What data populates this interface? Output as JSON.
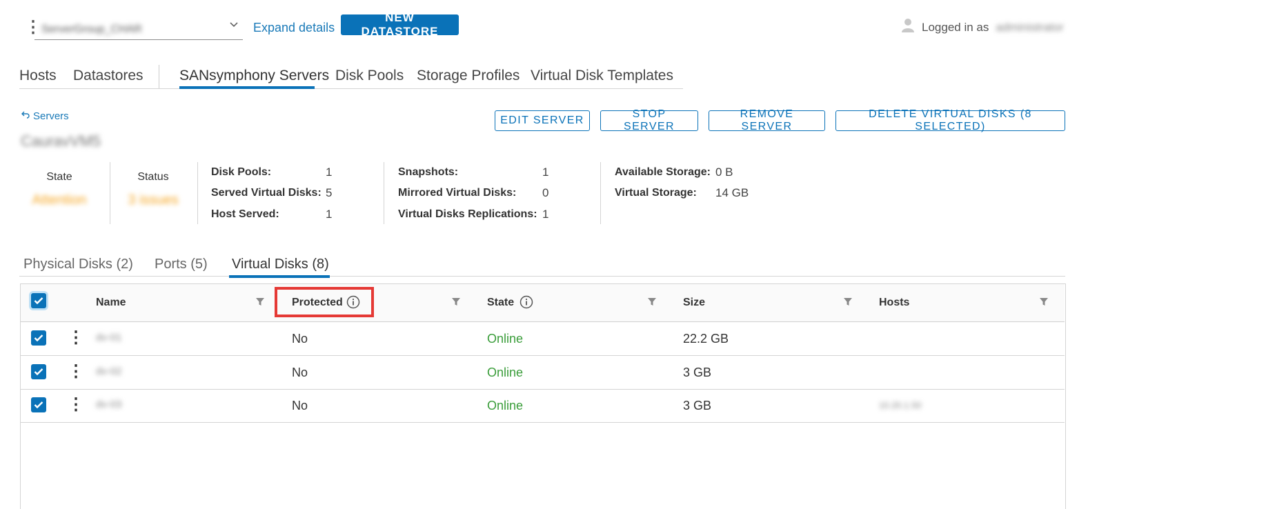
{
  "topbar": {
    "group_value": "ServerGroup_CHAR",
    "expand_details": "Expand details",
    "new_datastore": "NEW DATASTORE",
    "logged_in_as": "Logged in as",
    "username": "administrator"
  },
  "main_tabs": [
    {
      "label": "Hosts"
    },
    {
      "label": "Datastores"
    },
    {
      "label": "SANsymphony Servers"
    },
    {
      "label": "Disk Pools"
    },
    {
      "label": "Storage Profiles"
    },
    {
      "label": "Virtual Disk Templates"
    }
  ],
  "breadcrumb": {
    "label": "Servers"
  },
  "server_name": "CauravVM5",
  "actions": {
    "edit": "EDIT SERVER",
    "stop": "STOP SERVER",
    "remove": "REMOVE SERVER",
    "delete": "DELETE VIRTUAL DISKS (8 SELECTED)"
  },
  "summary": {
    "state_label": "State",
    "state_value": "Attention",
    "status_label": "Status",
    "status_value": "3 issues",
    "disk_pools_label": "Disk Pools:",
    "disk_pools": "1",
    "served_label": "Served Virtual Disks:",
    "served": "5",
    "host_served_label": "Host Served:",
    "host_served": "1",
    "snapshots_label": "Snapshots:",
    "snapshots": "1",
    "mirrored_label": "Mirrored Virtual Disks:",
    "mirrored": "0",
    "replications_label": "Virtual Disks Replications:",
    "replications": "1",
    "available_label": "Available Storage:",
    "available": "0 B",
    "virtual_label": "Virtual Storage:",
    "virtual": "14 GB"
  },
  "sub_tabs": [
    {
      "label": "Physical Disks (2)"
    },
    {
      "label": "Ports (5)"
    },
    {
      "label": "Virtual Disks (8)"
    }
  ],
  "table": {
    "columns": [
      "Name",
      "Protected",
      "State",
      "Size",
      "Hosts"
    ],
    "rows": [
      {
        "name": "dv-01",
        "protected": "No",
        "state": "Online",
        "size": "22.2 GB",
        "hosts": ""
      },
      {
        "name": "dv-02",
        "protected": "No",
        "state": "Online",
        "size": "3 GB",
        "hosts": ""
      },
      {
        "name": "dv-03",
        "protected": "No",
        "state": "Online",
        "size": "3 GB",
        "hosts": "10.20.1.50"
      }
    ]
  },
  "colors": {
    "accent": "#0a72b8",
    "online": "#3a9d3a",
    "attention": "#f5a623",
    "highlight": "#e53935"
  }
}
